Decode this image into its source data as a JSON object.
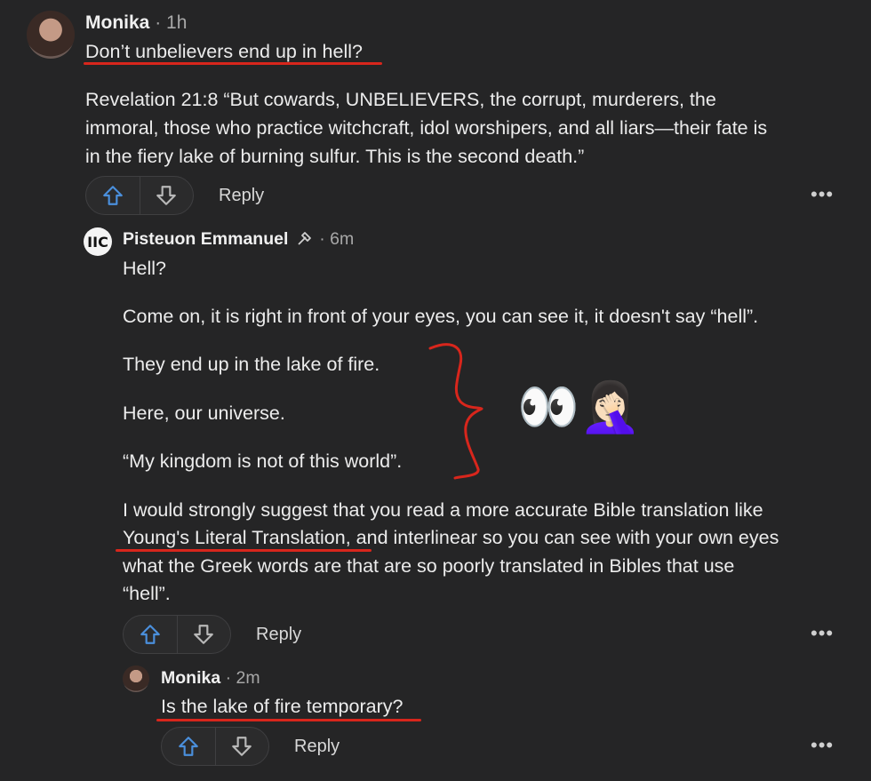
{
  "comments": [
    {
      "author": "Monika",
      "time": "1h",
      "title": "Don’t unbelievers end up in hell?",
      "body": [
        "Revelation 21:8 “But cowards, UNBELIEVERS, the corrupt, murderers, the",
        "immoral, those who practice witchcraft, idol worshipers, and all liars—their fate is",
        "in the fiery lake of burning sulfur. This is the second death.”"
      ],
      "reply_label": "Reply"
    },
    {
      "author": "Pisteuon Emmanuel",
      "time": "6m",
      "body_lines": [
        "Hell?",
        "Come on, it is right in front of your eyes, you can see it, it doesn't say “hell”.",
        "They end up in the lake of fire.",
        "Here, our universe.",
        "“My kingdom is not of this world”."
      ],
      "suggestion": {
        "line1": "I would strongly suggest that you read a more accurate Bible translation like",
        "link": "Young's Literal Translation",
        "line2_rest": ", and interlinear so you can see with your own eyes",
        "line3": "what the Greek words are that are so poorly translated in Bibles that use",
        "line4": "“hell”."
      },
      "reply_label": "Reply"
    },
    {
      "author": "Monika",
      "time": "2m",
      "body": "Is the lake of fire temporary?",
      "reply_label": "Reply"
    }
  ],
  "annotation_emoji": "👀🤦🏻‍♀️",
  "separator": "·",
  "more_glyph": "•••",
  "colors": {
    "background": "#252526",
    "annotation_red": "#d8261c",
    "upvote_blue": "#4a8fdc"
  }
}
